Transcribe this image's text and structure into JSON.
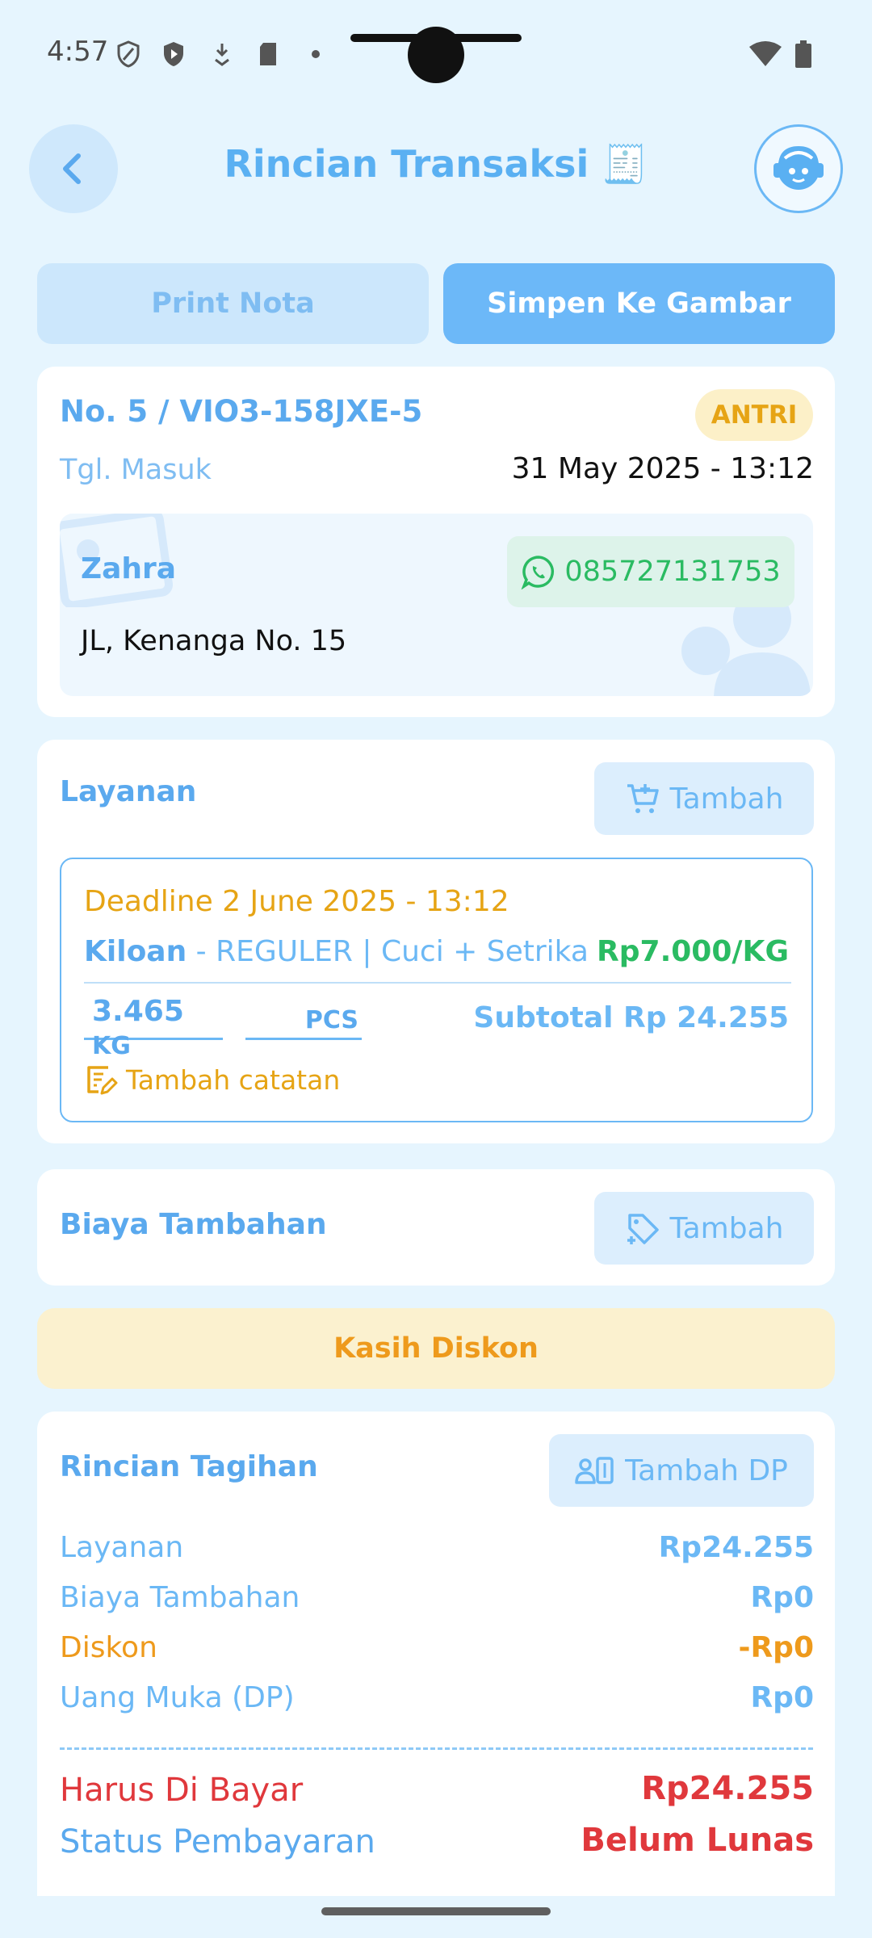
{
  "status_bar": {
    "time": "4:57"
  },
  "header": {
    "title": "Rincian Transaksi 🧾"
  },
  "actions": {
    "print_label": "Print Nota",
    "save_label": "Simpen Ke Gambar"
  },
  "order": {
    "number": "No. 5 / VIO3-158JXE-5",
    "status": "ANTRI",
    "date_label": "Tgl. Masuk",
    "date_value": "31 May 2025 - 13:12",
    "customer": {
      "name": "Zahra",
      "phone": "085727131753",
      "address": "JL, Kenanga No. 15"
    }
  },
  "layanan": {
    "title": "Layanan",
    "add_label": "Tambah",
    "item": {
      "deadline": "Deadline 2 June 2025 - 13:12",
      "type": "Kiloan",
      "desc": " - REGULER | Cuci + Setrika",
      "price": "Rp7.000/KG",
      "qty": "3.465",
      "qty_unit": "KG",
      "pcs_unit": "PCS",
      "subtotal": "Subtotal Rp 24.255",
      "note_label": "Tambah catatan"
    }
  },
  "biaya": {
    "title": "Biaya Tambahan",
    "add_label": "Tambah"
  },
  "diskon": {
    "label": "Kasih Diskon"
  },
  "tagihan": {
    "title": "Rincian Tagihan",
    "add_dp_label": "Tambah DP",
    "rows": [
      {
        "label": "Layanan",
        "value": "Rp24.255"
      },
      {
        "label": "Biaya Tambahan",
        "value": "Rp0"
      },
      {
        "label": "Diskon",
        "value": "-Rp0"
      },
      {
        "label": "Uang Muka (DP)",
        "value": "Rp0"
      }
    ],
    "total_label": "Harus Di Bayar",
    "total_value": "Rp24.255",
    "status_label": "Status Pembayaran",
    "status_value": "Belum Lunas"
  },
  "colors": {
    "background": "#E6F5FE",
    "primary": "#5AA9EE",
    "accent_button": "#6CB8F8",
    "warning": "#E6A415",
    "success": "#2ABB62",
    "danger": "#E0383C"
  }
}
